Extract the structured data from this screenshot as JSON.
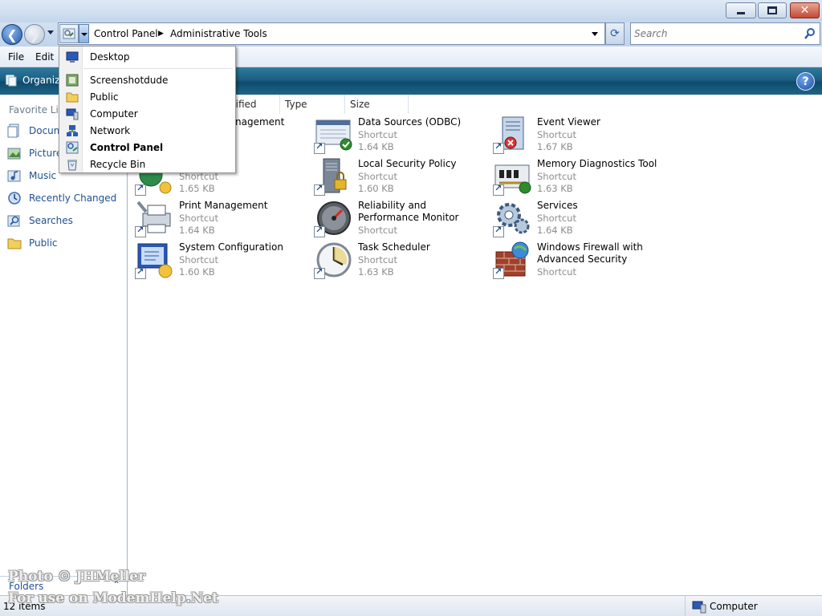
{
  "window": {
    "minimize_icon": "minimize-icon",
    "maximize_icon": "restore-icon",
    "close_icon": "close-icon",
    "close_symbol": "✕"
  },
  "address": {
    "back_symbol": "❮",
    "forward_symbol": "❯",
    "crumbs": [
      "Control Panel",
      "Administrative Tools"
    ],
    "separator": "▶",
    "refresh_symbol": "⟳"
  },
  "search": {
    "placeholder": "Search"
  },
  "menu": {
    "file": "File",
    "edit": "Edit"
  },
  "command_bar": {
    "organize": "Organiz",
    "help_symbol": "?"
  },
  "nav": {
    "favorites_heading": "Favorite Lin",
    "links": [
      {
        "label": "Docum",
        "icon": "documents-icon"
      },
      {
        "label": "Picture",
        "icon": "pictures-icon"
      },
      {
        "label": "Music",
        "icon": "music-icon"
      },
      {
        "label": "Recently Changed",
        "icon": "recently-changed-icon"
      },
      {
        "label": "Searches",
        "icon": "searches-icon"
      },
      {
        "label": "Public",
        "icon": "public-folder-icon"
      }
    ],
    "folders_label": "Folders",
    "folders_chevron": "⌃"
  },
  "columns": {
    "date_modified": "dified",
    "type": "Type",
    "size": "Size"
  },
  "items": [
    {
      "title": "nagement",
      "sub1": "",
      "sub2": "",
      "icon": "computer-management-icon"
    },
    {
      "title": "Data Sources (ODBC)",
      "sub1": "Shortcut",
      "sub2": "1.64 KB",
      "icon": "data-sources-icon"
    },
    {
      "title": "Event Viewer",
      "sub1": "Shortcut",
      "sub2": "1.67 KB",
      "icon": "event-viewer-icon"
    },
    {
      "title": "",
      "sub1": "Shortcut",
      "sub2": "1.65 KB",
      "icon": "iscsi-initiator-icon"
    },
    {
      "title": "Local Security Policy",
      "sub1": "Shortcut",
      "sub2": "1.60 KB",
      "icon": "local-security-policy-icon"
    },
    {
      "title": "Memory Diagnostics Tool",
      "sub1": "Shortcut",
      "sub2": "1.63 KB",
      "icon": "memory-diagnostics-icon"
    },
    {
      "title": "Print Management",
      "sub1": "Shortcut",
      "sub2": "1.64 KB",
      "icon": "print-management-icon"
    },
    {
      "title": "Reliability and Performance Monitor",
      "sub1": "Shortcut",
      "sub2": "",
      "icon": "reliability-monitor-icon"
    },
    {
      "title": "Services",
      "sub1": "Shortcut",
      "sub2": "1.64 KB",
      "icon": "services-icon"
    },
    {
      "title": "System Configuration",
      "sub1": "Shortcut",
      "sub2": "1.60 KB",
      "icon": "system-configuration-icon"
    },
    {
      "title": "Task Scheduler",
      "sub1": "Shortcut",
      "sub2": "1.63 KB",
      "icon": "task-scheduler-icon"
    },
    {
      "title": "Windows Firewall with Advanced Security",
      "sub1": "Shortcut",
      "sub2": "",
      "icon": "windows-firewall-icon"
    }
  ],
  "dropdown": {
    "items": [
      {
        "label": "Desktop",
        "icon": "desktop-icon"
      },
      {
        "label": "Screenshotdude",
        "icon": "user-folder-icon"
      },
      {
        "label": "Public",
        "icon": "public-folder-icon"
      },
      {
        "label": "Computer",
        "icon": "computer-icon"
      },
      {
        "label": "Network",
        "icon": "network-icon"
      },
      {
        "label": "Control Panel",
        "icon": "control-panel-icon"
      },
      {
        "label": "Recycle Bin",
        "icon": "recycle-bin-icon"
      }
    ]
  },
  "status": {
    "count": "12 items",
    "zone": "Computer",
    "zone_icon": "computer-icon"
  },
  "watermark": {
    "line1": "Photo © JHMeller",
    "line2": "For use on ModemHelp.Net"
  }
}
